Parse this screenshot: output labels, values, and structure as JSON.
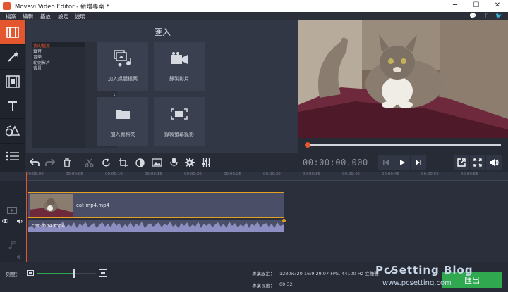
{
  "window": {
    "title": "Movavi Video Editor - 新增專案 *",
    "min": "─",
    "max": "☐",
    "close": "✕"
  },
  "menu": [
    "檔案",
    "編輯",
    "播放",
    "設定",
    "說明"
  ],
  "social": [
    "💬",
    "f",
    "🐦"
  ],
  "sidebar_tools": [
    "import-icon",
    "magic-wand-icon",
    "filmstrip-icon",
    "text-icon",
    "shapes-icon",
    "menu-lines-icon"
  ],
  "import": {
    "title": "匯入",
    "files": [
      "我的檔案",
      "聲音",
      "音樂",
      "範例影片",
      "背景"
    ],
    "collapse": "‹",
    "tiles": [
      {
        "label": "加入媒體檔案",
        "icon": "media-files-icon"
      },
      {
        "label": "錄製影片",
        "icon": "camera-icon"
      },
      {
        "label": "加入資料夾",
        "icon": "folder-icon"
      },
      {
        "label": "錄製螢幕錄影",
        "icon": "screen-record-icon"
      }
    ]
  },
  "toolbar": [
    "undo-icon",
    "redo-icon",
    "trash-icon",
    "scissors-icon",
    "rotate-icon",
    "crop-icon",
    "color-icon",
    "image-icon",
    "mic-icon",
    "gear-icon",
    "equalizer-icon"
  ],
  "player": {
    "timecode": "00:00:00.000",
    "progress": 0
  },
  "timeline": {
    "ticks": [
      "00:00:00",
      "00:00:05",
      "00:00:10",
      "00:00:15",
      "00:00:20",
      "00:00:25",
      "00:00:30",
      "00:00:35",
      "00:00:40",
      "00:00:45",
      "00:00:50",
      "00:00:55"
    ],
    "video_clip": "cat-mp4.mp4",
    "audio_clip": "cat-mp4.mp4"
  },
  "status": {
    "zoom_label": "刻度：",
    "zoom_level": 0.62,
    "settings_label": "專案設定：",
    "settings_value": "1280x720 16:9 29.97 FPS, 44100 Hz 立體聲",
    "length_label": "專案長度：",
    "length_value": "00:32",
    "export": "匯出"
  },
  "watermark": {
    "line1": "PcSetting Blog",
    "line2": "www.pcsetting.com"
  },
  "colors": {
    "accent": "#e4572e",
    "export": "#2fa84f",
    "clip_border": "#e4a020"
  }
}
